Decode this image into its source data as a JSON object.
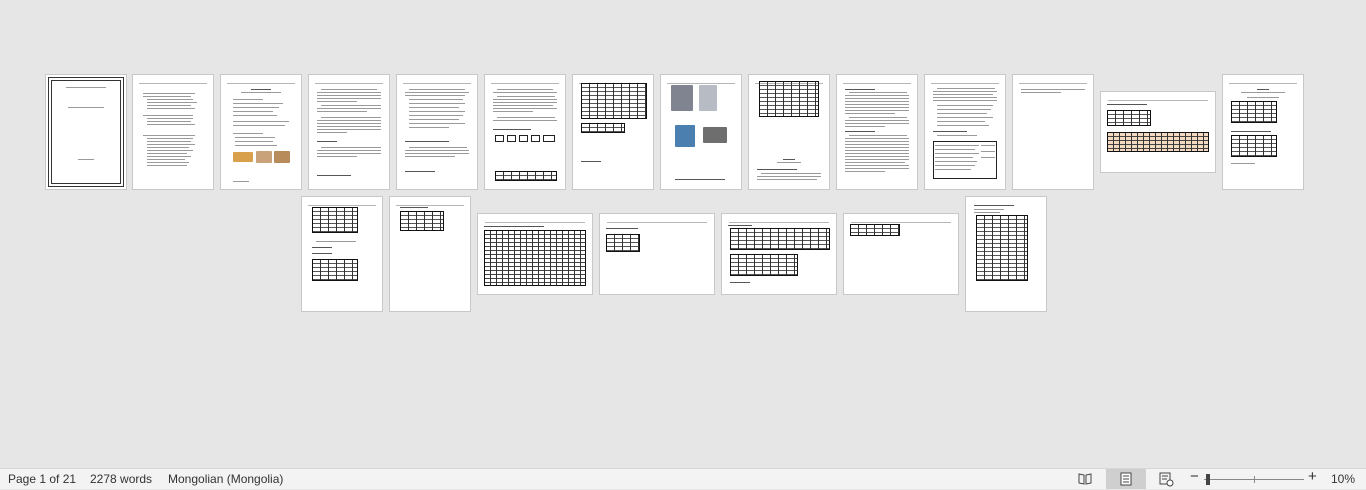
{
  "statusbar": {
    "page_info": "Page 1 of 21",
    "word_count": "2278 words",
    "language": "Mongolian (Mongolia)",
    "zoom_out_symbol": "−",
    "zoom_in_symbol": "+",
    "zoom_level": "10%",
    "view_icons": [
      "read-mode-icon",
      "print-layout-icon",
      "web-layout-icon"
    ]
  },
  "document": {
    "page_count": 21
  }
}
